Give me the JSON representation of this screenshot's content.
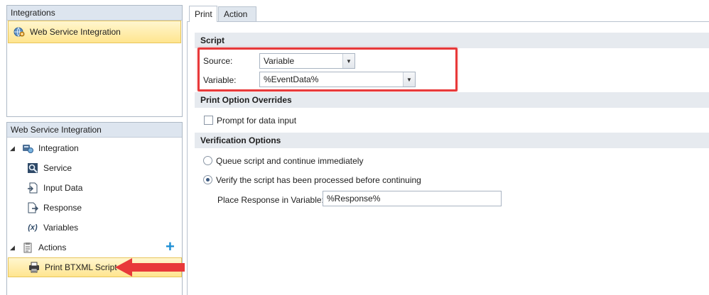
{
  "integrations_panel": {
    "title": "Integrations",
    "items": [
      {
        "label": "Web Service Integration",
        "icon": "globe-gear-icon"
      }
    ]
  },
  "tree_panel": {
    "title": "Web Service Integration",
    "integration": {
      "label": "Integration",
      "icon": "integration-icon"
    },
    "children": [
      {
        "label": "Service",
        "icon": "service-icon"
      },
      {
        "label": "Input Data",
        "icon": "input-data-icon"
      },
      {
        "label": "Response",
        "icon": "response-icon"
      },
      {
        "label": "Variables",
        "icon": "variables-icon",
        "glyph": "(x)"
      }
    ],
    "actions": {
      "label": "Actions",
      "icon": "actions-icon",
      "add_glyph": "+"
    },
    "selected_action": {
      "label": "Print BTXML Script",
      "icon": "printer-icon"
    }
  },
  "tabs": [
    {
      "label": "Print",
      "active": true
    },
    {
      "label": "Action",
      "active": false
    }
  ],
  "script_section": {
    "title": "Script",
    "source_label": "Source:",
    "source_value": "Variable",
    "variable_label": "Variable:",
    "variable_value": "%EventData%"
  },
  "overrides_section": {
    "title": "Print Option Overrides",
    "prompt_label": "Prompt for data input",
    "prompt_checked": false
  },
  "verification_section": {
    "title": "Verification Options",
    "option_queue": "Queue script and continue immediately",
    "option_verify": "Verify the script has been processed before continuing",
    "selected": "verify",
    "response_label": "Place Response in Variable:",
    "response_value": "%Response%"
  },
  "colors": {
    "highlight_red": "#e8393a",
    "selection_yellow": "#ffe58f",
    "header_blue": "#dde5ef"
  }
}
